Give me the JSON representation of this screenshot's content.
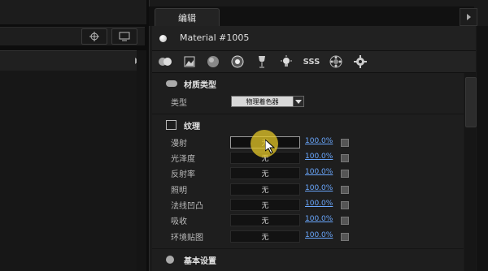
{
  "panel": {
    "tab_title": "编辑",
    "material_name": "Material #1005"
  },
  "toolbar_icons": [
    "material-preview-icon",
    "image-icon",
    "sphere-icon",
    "shader-icon",
    "wine-glass-icon",
    "lightbulb-icon",
    "sss-icon",
    "reflection-icon",
    "gear-icon"
  ],
  "toolbar_text": {
    "sss": "SSS"
  },
  "material_type": {
    "section_title": "材质类型",
    "type_label": "类型",
    "type_value": "物理着色器"
  },
  "texture": {
    "section_title": "纹理",
    "rows": [
      {
        "label": "漫射",
        "value": "无",
        "percent": "100.0%"
      },
      {
        "label": "光泽度",
        "value": "无",
        "percent": "100.0%"
      },
      {
        "label": "反射率",
        "value": "无",
        "percent": "100.0%"
      },
      {
        "label": "照明",
        "value": "无",
        "percent": "100.0%"
      },
      {
        "label": "法线凹凸",
        "value": "无",
        "percent": "100.0%"
      },
      {
        "label": "吸收",
        "value": "无",
        "percent": "100.0%"
      },
      {
        "label": "环境贴图",
        "value": "无",
        "percent": "100.0%"
      }
    ]
  },
  "basic": {
    "section_title": "基本设置"
  },
  "colors": {
    "accent_link": "#6aa8ff",
    "panel_bg": "#1e1e1e"
  }
}
